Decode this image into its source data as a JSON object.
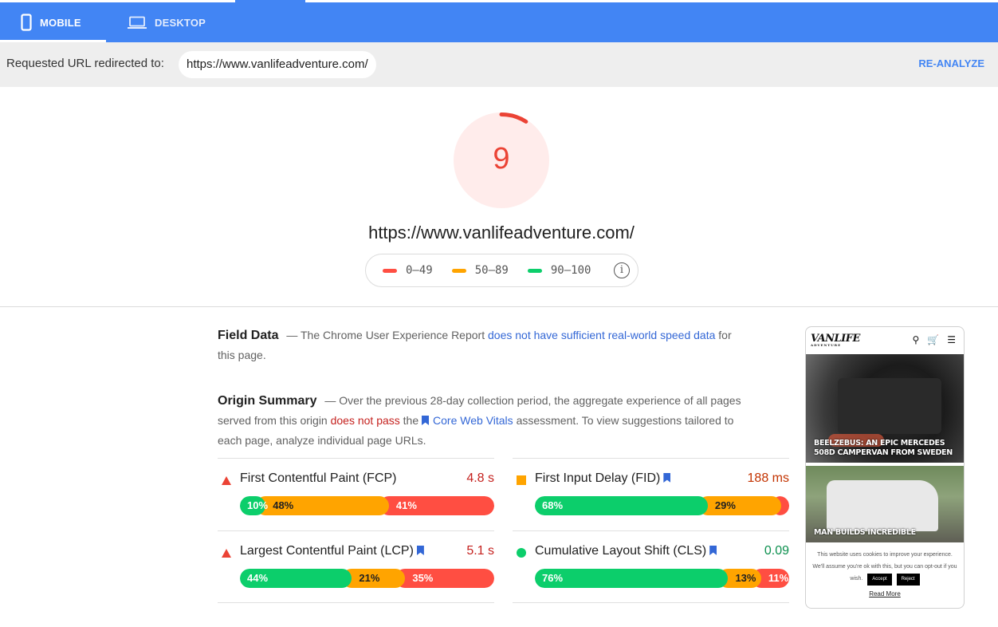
{
  "tabs": {
    "mobile": "MOBILE",
    "desktop": "DESKTOP"
  },
  "redirect": {
    "label": "Requested URL redirected to:",
    "url": "https://www.vanlifeadventure.com/",
    "reanalyze": "RE-ANALYZE"
  },
  "score": {
    "value": "9",
    "fraction": 0.09,
    "color": "#eb4335",
    "url": "https://www.vanlifeadventure.com/"
  },
  "legend": [
    {
      "range": "0–49",
      "color": "#ff4e42"
    },
    {
      "range": "50–89",
      "color": "#ffa400"
    },
    {
      "range": "90–100",
      "color": "#0cce6b"
    }
  ],
  "field_data": {
    "title": "Field Data",
    "dash": "—",
    "text1": "The Chrome User Experience Report",
    "link": "does not have sufficient real-world speed data",
    "text2": "for this page."
  },
  "origin_summary": {
    "title": "Origin Summary",
    "dash": "—",
    "text1": "Over the previous 28-day collection period, the aggregate experience of all pages served from this origin",
    "fail": "does not pass",
    "text2": "the",
    "link": "Core Web Vitals",
    "text3": "assessment. To view suggestions tailored to each page, analyze individual page URLs."
  },
  "metrics": [
    {
      "name": "First Contentful Paint (FCP)",
      "value": "4.8 s",
      "status": "fail",
      "value_color": "#c5221f",
      "bookmark": false,
      "dist": [
        {
          "label": "10%",
          "pct": 10
        },
        {
          "label": "48%",
          "pct": 48
        },
        {
          "label": "41%",
          "pct": 41
        }
      ]
    },
    {
      "name": "First Input Delay (FID)",
      "value": "188 ms",
      "status": "average",
      "value_color": "#c33300",
      "bookmark": true,
      "dist": [
        {
          "label": "68%",
          "pct": 68
        },
        {
          "label": "29%",
          "pct": 29
        },
        {
          "label": "3%",
          "pct": 3
        }
      ]
    },
    {
      "name": "Largest Contentful Paint (LCP)",
      "value": "5.1 s",
      "status": "fail",
      "value_color": "#c5221f",
      "bookmark": true,
      "dist": [
        {
          "label": "44%",
          "pct": 44
        },
        {
          "label": "21%",
          "pct": 21
        },
        {
          "label": "35%",
          "pct": 35
        }
      ]
    },
    {
      "name": "Cumulative Layout Shift (CLS)",
      "value": "0.09",
      "status": "pass",
      "value_color": "#0d904f",
      "bookmark": true,
      "dist": [
        {
          "label": "76%",
          "pct": 76
        },
        {
          "label": "13%",
          "pct": 13
        },
        {
          "label": "11%",
          "pct": 11
        }
      ]
    }
  ],
  "preview": {
    "logo": "VANLIFE",
    "logo_sub": "ADVENTURE",
    "caption1": "BEELZEBUS: AN EPIC MERCEDES 508D CAMPERVAN FROM SWEDEN",
    "caption2": "MAN BUILDS INCREDIBLE",
    "cookie_text": "This website uses cookies to improve your experience. We'll assume you're ok with this, but you can opt-out if you wish.",
    "accept": "Accept",
    "reject": "Reject",
    "read_more": "Read More"
  }
}
